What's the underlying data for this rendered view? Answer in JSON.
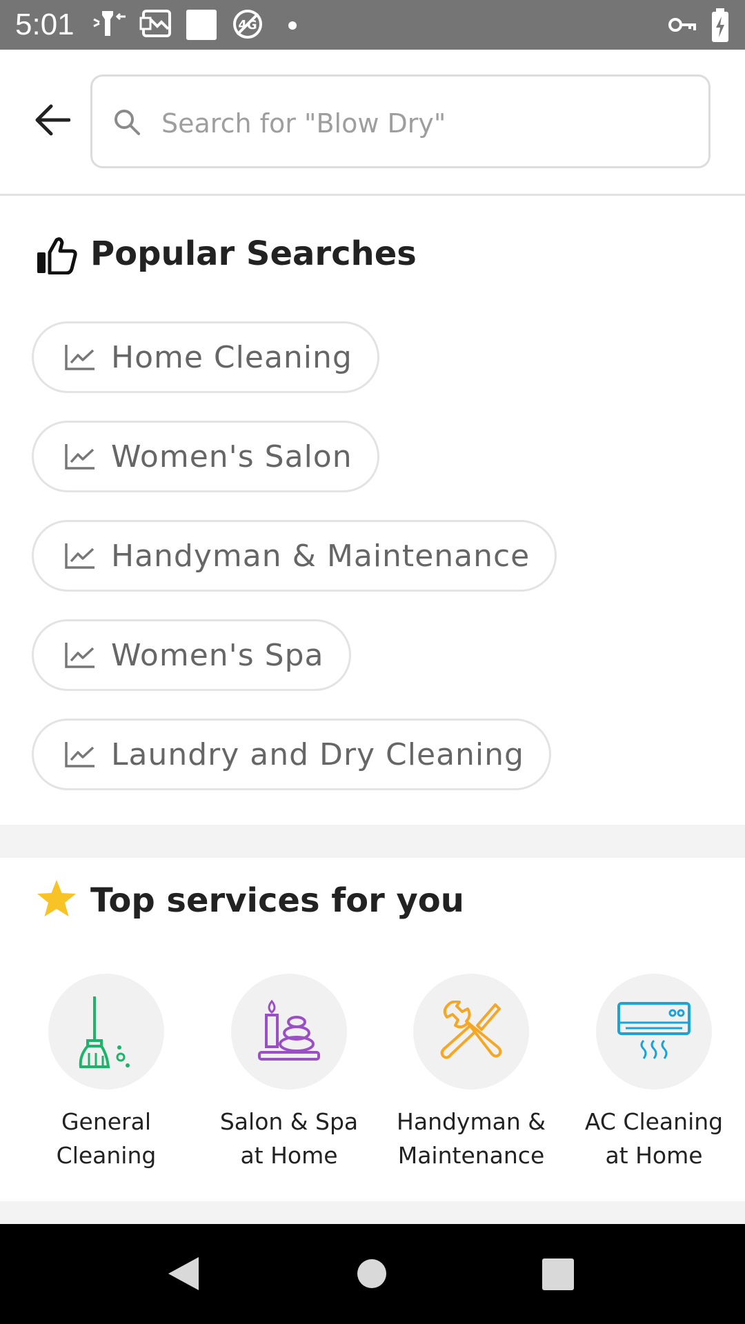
{
  "status_bar": {
    "time": "5:01",
    "left_icons": [
      "figure-notification-icon",
      "photo-notification-icon",
      "blank-notification-icon",
      "no-4g-icon",
      "dot-icon"
    ],
    "right_icons": [
      "vpn-key-icon",
      "battery-charging-icon"
    ]
  },
  "search": {
    "placeholder": "Search for \"Blow Dry\"",
    "value": ""
  },
  "popular": {
    "title": "Popular Searches",
    "icon": "thumbs-up-icon",
    "items": [
      {
        "label": "Home Cleaning",
        "icon": "trending-icon"
      },
      {
        "label": "Women's Salon",
        "icon": "trending-icon"
      },
      {
        "label": "Handyman & Maintenance",
        "icon": "trending-icon"
      },
      {
        "label": "Women's Spa",
        "icon": "trending-icon"
      },
      {
        "label": "Laundry and Dry Cleaning",
        "icon": "trending-icon"
      }
    ]
  },
  "top_services": {
    "title": "Top services for you",
    "icon": "star-icon",
    "items": [
      {
        "label": "General\nCleaning",
        "icon": "broom-icon",
        "color": "#1db36b"
      },
      {
        "label": "Salon & Spa\nat Home",
        "icon": "spa-stones-icon",
        "color": "#9b4fc4"
      },
      {
        "label": "Handyman &\nMaintenance",
        "icon": "tools-icon",
        "color": "#f5a623"
      },
      {
        "label": "AC Cleaning\nat Home",
        "icon": "air-conditioner-icon",
        "color": "#1aa3d9"
      }
    ]
  },
  "colors": {
    "status_bar": "#757575",
    "star": "#f7c325",
    "chip_border": "#e3e3e3",
    "chip_text": "#666666"
  },
  "nav": [
    "back-nav-icon",
    "home-nav-icon",
    "recents-nav-icon"
  ]
}
